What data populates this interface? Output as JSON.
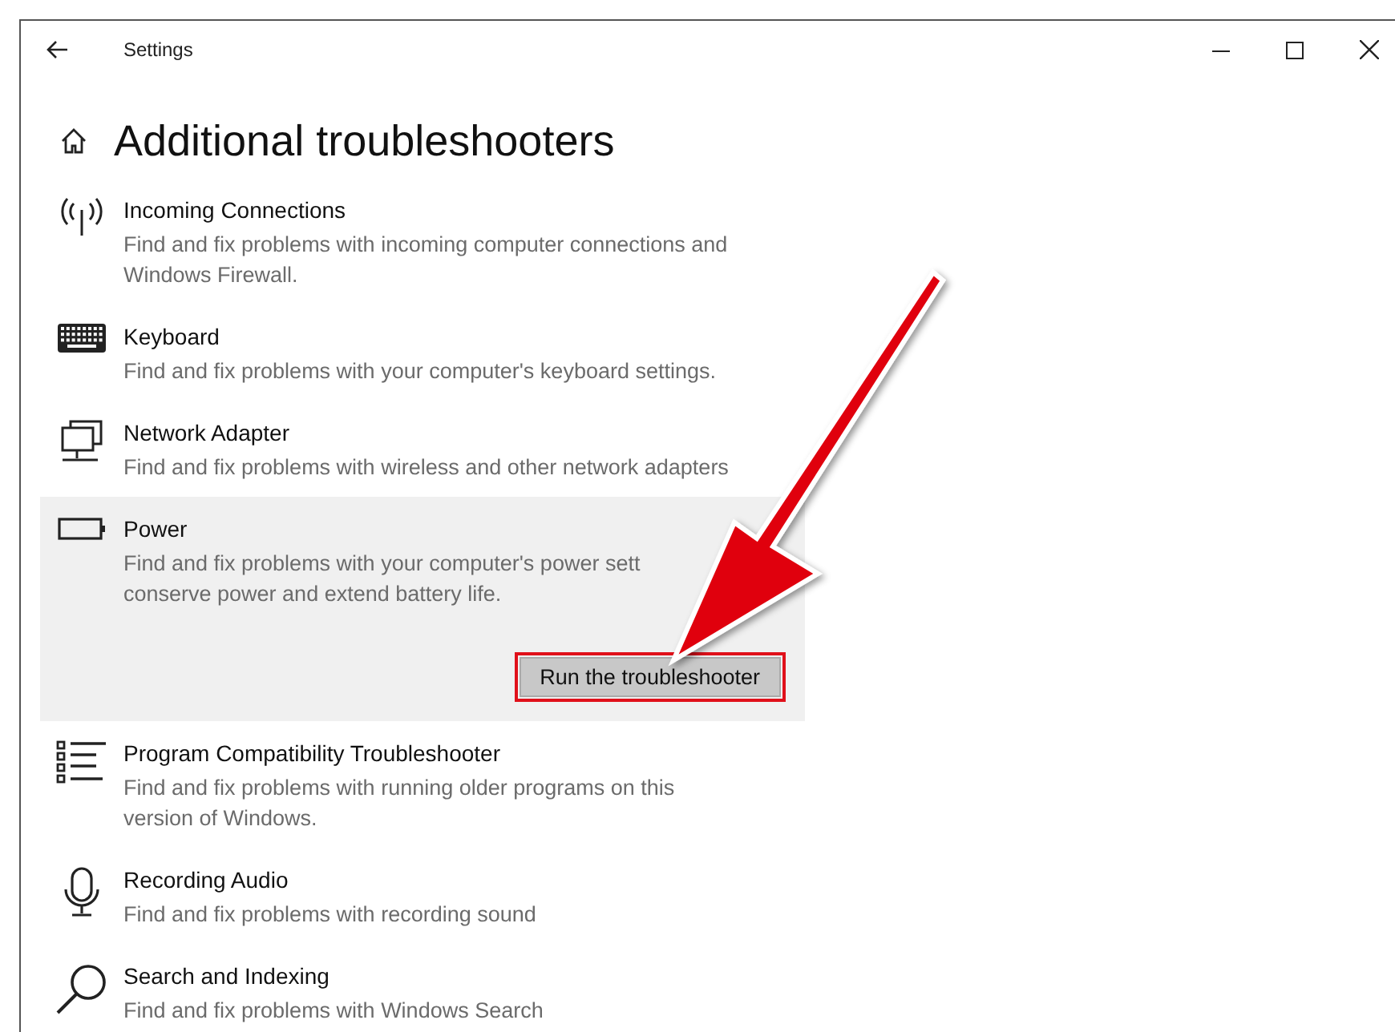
{
  "window": {
    "title": "Settings"
  },
  "heading": "Additional troubleshooters",
  "items": [
    {
      "title": "Incoming Connections",
      "description": [
        "Find and fix problems with incoming computer connections and",
        "Windows Firewall."
      ],
      "selected": false
    },
    {
      "title": "Keyboard",
      "description": [
        "Find and fix problems with your computer's keyboard settings."
      ],
      "selected": false
    },
    {
      "title": "Network Adapter",
      "description": [
        "Find and fix problems with wireless and other network adapters"
      ],
      "selected": false
    },
    {
      "title": "Power",
      "description": [
        "Find and fix problems with your computer's power sett",
        "conserve power and extend battery life."
      ],
      "selected": true,
      "button": "Run the troubleshooter"
    },
    {
      "title": "Program Compatibility Troubleshooter",
      "description": [
        "Find and fix problems with running older programs on this",
        "version of Windows."
      ],
      "selected": false
    },
    {
      "title": "Recording Audio",
      "description": [
        "Find and fix problems with recording sound"
      ],
      "selected": false
    },
    {
      "title": "Search and Indexing",
      "description": [
        "Find and fix problems with Windows Search"
      ],
      "selected": false
    }
  ]
}
